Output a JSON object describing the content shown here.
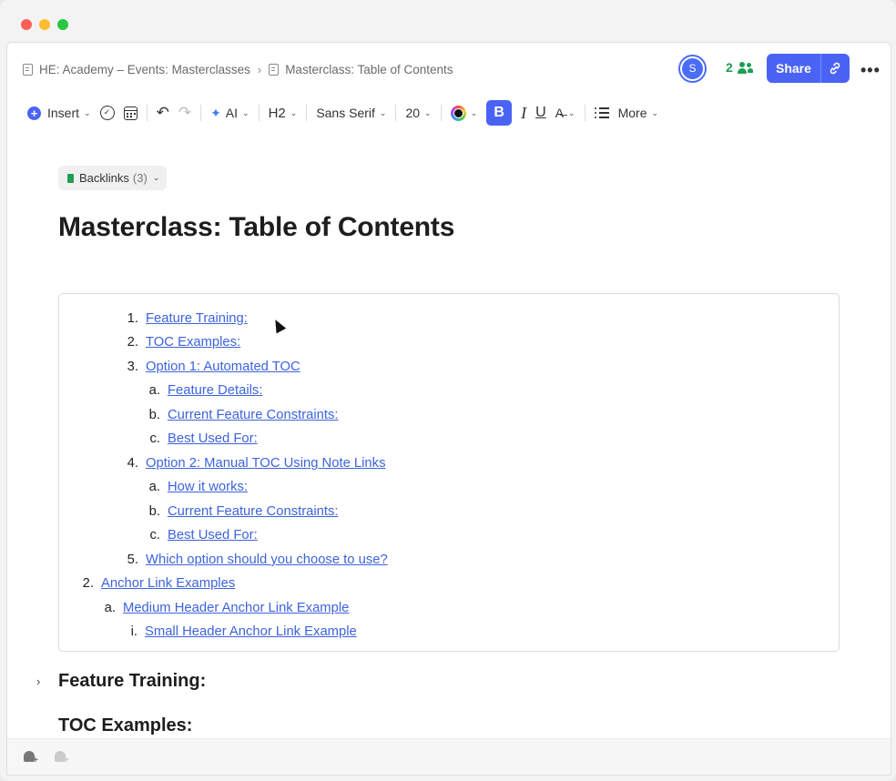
{
  "window": {
    "title": "Masterclass: Table of Contents"
  },
  "breadcrumb": {
    "parent": "HE: Academy – Events: Masterclasses",
    "separator": "›",
    "current": "Masterclass: Table of Contents"
  },
  "header": {
    "avatar_initial": "S",
    "collaborators_count": "2",
    "share_label": "Share",
    "more_label": "•••"
  },
  "toolbar": {
    "insert_label": "Insert",
    "ai_label": "AI",
    "heading_label": "H2",
    "font_label": "Sans Serif",
    "size_label": "20",
    "bold_label": "B",
    "italic_label": "I",
    "underline_label": "U",
    "more_label": "More",
    "text_color": "#111111",
    "accent_color": "#4a63f5"
  },
  "backlinks": {
    "label": "Backlinks",
    "count": "(3)"
  },
  "page": {
    "title": "Masterclass: Table of Contents"
  },
  "toc": [
    {
      "marker": "1.",
      "text": "Feature Training:"
    },
    {
      "marker": "2.",
      "text": "TOC Examples:"
    },
    {
      "marker": "3.",
      "text": "Option 1: Automated TOC "
    },
    {
      "marker": "a.",
      "text": "Feature Details:"
    },
    {
      "marker": "b.",
      "text": "Current Feature Constraints:"
    },
    {
      "marker": "c.",
      "text": "Best Used For:"
    },
    {
      "marker": "4.",
      "text": "Option 2: Manual TOC Using Note Links"
    },
    {
      "marker": "a.",
      "text": "How it works:"
    },
    {
      "marker": "b.",
      "text": "Current Feature Constraints:"
    },
    {
      "marker": "c.",
      "text": "Best Used For:"
    },
    {
      "marker": "5.",
      "text": "Which option should you choose to use?"
    },
    {
      "marker": "2.",
      "text": "Anchor Link Examples"
    },
    {
      "marker": "a.",
      "text": "Medium Header Anchor Link Example"
    },
    {
      "marker": "i.",
      "text": "Small Header Anchor Link Example"
    }
  ],
  "sections": {
    "feature_training": "Feature Training:",
    "toc_examples": "TOC Examples:"
  },
  "colors": {
    "link": "#3d63dd",
    "accent": "#4a63f5",
    "collab_green": "#1f9d55"
  }
}
